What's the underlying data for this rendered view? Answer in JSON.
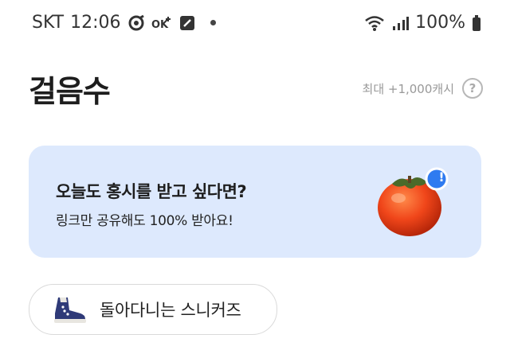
{
  "status_bar": {
    "carrier": "SKT",
    "time": "12:06",
    "battery": "100%"
  },
  "header": {
    "title": "걸음수",
    "reward_text": "최대 +1,000캐시",
    "help_label": "?"
  },
  "banner": {
    "title": "오늘도 홍시를 받고 싶다면?",
    "subtitle": "링크만 공유해도 100% 받아요!",
    "badge": "!"
  },
  "chip": {
    "label": "돌아다니는 스니커즈"
  }
}
